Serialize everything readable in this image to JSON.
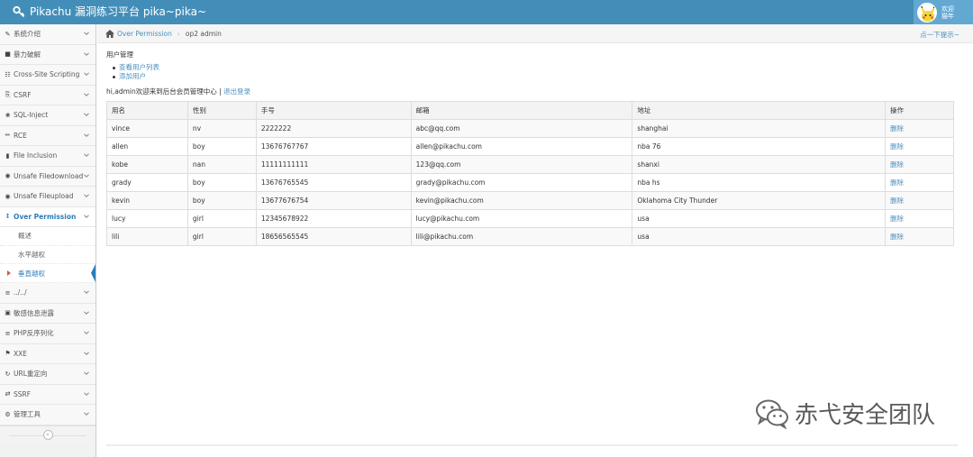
{
  "app": {
    "title": "Pikachu 漏洞练习平台 pika~pika~",
    "user_line1": "欢迎",
    "user_line2": "猫年"
  },
  "sidebar": {
    "items": [
      {
        "label": "系统介绍",
        "icon": "tag-icon"
      },
      {
        "label": "暴力破解",
        "icon": "lock-icon"
      },
      {
        "label": "Cross-Site Scripting",
        "icon": "network-icon"
      },
      {
        "label": "CSRF",
        "icon": "share-icon"
      },
      {
        "label": "SQL-Inject",
        "icon": "plug-icon"
      },
      {
        "label": "RCE",
        "icon": "pencil-icon"
      },
      {
        "label": "File Inclusion",
        "icon": "file-icon"
      },
      {
        "label": "Unsafe Filedownload",
        "icon": "circle-down-icon"
      },
      {
        "label": "Unsafe Fileupload",
        "icon": "circle-up-icon"
      },
      {
        "label": "Over Permission",
        "icon": "text-height-icon"
      },
      {
        "label": "../../",
        "icon": "align-icon"
      },
      {
        "label": "敏感信息泄露",
        "icon": "camera-icon"
      },
      {
        "label": "PHP反序列化",
        "icon": "list-icon"
      },
      {
        "label": "XXE",
        "icon": "flag-icon"
      },
      {
        "label": "URL重定向",
        "icon": "refresh-icon"
      },
      {
        "label": "SSRF",
        "icon": "exchange-icon"
      },
      {
        "label": "管理工具",
        "icon": "gear-icon"
      }
    ],
    "sub_items": [
      {
        "label": "概述"
      },
      {
        "label": "水平越权"
      },
      {
        "label": "垂直越权"
      }
    ]
  },
  "breadcrumb": {
    "parent": "Over Permission",
    "current": "op2 admin",
    "tip": "点一下提示~"
  },
  "main": {
    "section_title": "用户管理",
    "links": [
      "查看用户列表",
      "添加用户"
    ],
    "welcome_text": "hi,admin欢迎来到后台会员管理中心 | ",
    "logout_label": "退出登录"
  },
  "table": {
    "headers": [
      "用名",
      "性别",
      "手号",
      "邮箱",
      "地址",
      "操作"
    ],
    "rows": [
      [
        "vince",
        "nv",
        "2222222",
        "abc@qq.com",
        "shanghai",
        "删除"
      ],
      [
        "allen",
        "boy",
        "13676767767",
        "allen@pikachu.com",
        "nba 76",
        "删除"
      ],
      [
        "kobe",
        "nan",
        "11111111111",
        "123@qq.com",
        "shanxi",
        "删除"
      ],
      [
        "grady",
        "boy",
        "13676765545",
        "grady@pikachu.com",
        "nba hs",
        "删除"
      ],
      [
        "kevin",
        "boy",
        "13677676754",
        "kevin@pikachu.com",
        "Oklahoma City Thunder",
        "删除"
      ],
      [
        "lucy",
        "girl",
        "12345678922",
        "lucy@pikachu.com",
        "usa",
        "删除"
      ],
      [
        "lili",
        "girl",
        "18656565545",
        "lili@pikachu.com",
        "usa",
        "删除"
      ]
    ]
  },
  "watermark": "赤弋安全团队",
  "colors": {
    "navbar": "#438eb9",
    "link": "#4c8fbd",
    "active_accent": "#2b7dbc"
  }
}
